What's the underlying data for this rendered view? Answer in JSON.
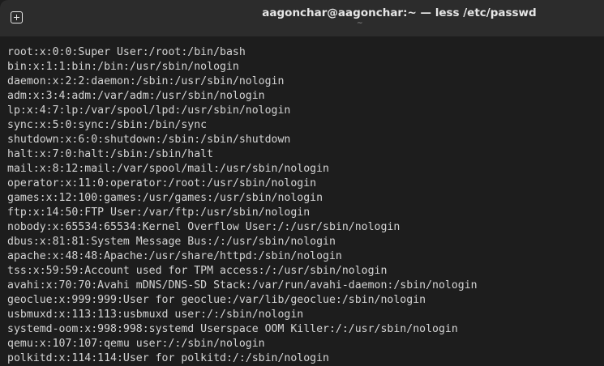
{
  "window": {
    "title": "aagonchar@aagonchar:~ — less /etc/passwd",
    "subtitle": "~",
    "new_tab_icon": "plus-square-icon"
  },
  "terminal": {
    "lines": [
      "root:x:0:0:Super User:/root:/bin/bash",
      "bin:x:1:1:bin:/bin:/usr/sbin/nologin",
      "daemon:x:2:2:daemon:/sbin:/usr/sbin/nologin",
      "adm:x:3:4:adm:/var/adm:/usr/sbin/nologin",
      "lp:x:4:7:lp:/var/spool/lpd:/usr/sbin/nologin",
      "sync:x:5:0:sync:/sbin:/bin/sync",
      "shutdown:x:6:0:shutdown:/sbin:/sbin/shutdown",
      "halt:x:7:0:halt:/sbin:/sbin/halt",
      "mail:x:8:12:mail:/var/spool/mail:/usr/sbin/nologin",
      "operator:x:11:0:operator:/root:/usr/sbin/nologin",
      "games:x:12:100:games:/usr/games:/usr/sbin/nologin",
      "ftp:x:14:50:FTP User:/var/ftp:/usr/sbin/nologin",
      "nobody:x:65534:65534:Kernel Overflow User:/:/usr/sbin/nologin",
      "dbus:x:81:81:System Message Bus:/:/usr/sbin/nologin",
      "apache:x:48:48:Apache:/usr/share/httpd:/sbin/nologin",
      "tss:x:59:59:Account used for TPM access:/:/usr/sbin/nologin",
      "avahi:x:70:70:Avahi mDNS/DNS-SD Stack:/var/run/avahi-daemon:/sbin/nologin",
      "geoclue:x:999:999:User for geoclue:/var/lib/geoclue:/sbin/nologin",
      "usbmuxd:x:113:113:usbmuxd user:/:/sbin/nologin",
      "systemd-oom:x:998:998:systemd Userspace OOM Killer:/:/usr/sbin/nologin",
      "qemu:x:107:107:qemu user:/:/sbin/nologin",
      "polkitd:x:114:114:User for polkitd:/:/sbin/nologin"
    ]
  }
}
